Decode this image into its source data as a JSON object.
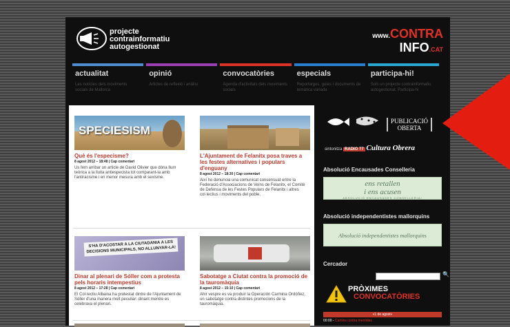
{
  "site": {
    "logo_lines": [
      "projecte",
      "contrainformatiu",
      "autogestionat"
    ],
    "brand_www": "www.",
    "brand_contra": "CONTRA",
    "brand_info": "INFO",
    "brand_tld": ".CAT"
  },
  "nav": [
    {
      "label": "actualitat",
      "desc": "Les notícies dels moviments socials de Mallorca",
      "color": "#4f8fd1"
    },
    {
      "label": "opinió",
      "desc": "Articles de reflexió i anàlisi",
      "color": "#9b3fb5"
    },
    {
      "label": "convocatòries",
      "desc": "Agenda d'activitats dels moviments socials",
      "color": "#e03127"
    },
    {
      "label": "especials",
      "desc": "Reportatges, guies i documents de temàtica variada",
      "color": "#2b7fd1"
    },
    {
      "label": "participa-hi!",
      "desc": "Sols un projecte contrainformatiu autogestionat. Participa-hi",
      "color": "#2ba8d1"
    }
  ],
  "posts": [
    {
      "title": "Què és l'especisme?",
      "meta": "8 agost 2012 – 18:48 | Cap comentari",
      "excerpt": "Us fem arribar un article de David Olivier que dóna llum teòrica a la lluita antiespecista tot comparant-la amb l'antiracisme i en menor mesura amb el sexisme.",
      "thumb_text": "SPECIESISM"
    },
    {
      "title": "L'Ajuntament de Felanitx posa traves a les festes alternatives i populars d'enguany",
      "meta": "8 agost 2012 – 18:30 | Cap comentari",
      "excerpt": "Així ho denuncia una comunicat consensuat entre la Federació d'Associacions de Veïns de Felanitx, el Comitè de Defensa de les Festes Populars de Felanitx i altres col·lectius i moviments del poble."
    },
    {
      "title": "Dinar al plenari de Sóller com a protesta pels horaris intempestius",
      "meta": "8 agost 2012 – 17:28 | Cap comentari",
      "excerpt": "El Col·lectiu Albaina ha protestat dintre de l'Ajuntament de Sóller d'una manera molt peculiar: dinant mentre es celebrava el plenari.",
      "thumb_text": "S'HA D'ACOSTAR A LA CIUTADANIA A LES DECISIONS MUNICIPALS, NO ALLUNYAR-LA!"
    },
    {
      "title": "Sabotatge a Ciutat contra la promoció de la tauromàquia",
      "meta": "8 agost 2012 – 15:10 | Cap comentari",
      "excerpt": "Ahir vespre es va produir la Operación Carmina Ordóñez, un sabotatge contra distintes promocions de la tauromàquia."
    }
  ],
  "sidebar": {
    "pub_line1": "PUBLICACIÓ",
    "pub_line2": "OBERTA",
    "radio_prefix": "sintonitza",
    "radio_station": "RADIO 77",
    "radio_name": "Cultura Obrera",
    "section1_title": "Absolució Encausades Conselleria",
    "banner1_line1": "ens retallen",
    "banner1_line2": "i ens acusen",
    "banner1_line3": "ABSOLUCIÓ ENCAUSADES CONSELLERIA!",
    "section2_title": "Absolució independentistes mallorquins",
    "banner2": "Absolució independentistes mallorquins",
    "search_title": "Cercador",
    "prox_line1": "PRÒXIMES",
    "prox_line2": "CONVOCATÒRIES",
    "date_bar": "»1 de agost«",
    "event_time": "00:00 -",
    "event_text": "Camins contra mentides"
  },
  "colors": {
    "accent": "#e03127",
    "link": "#c0392b"
  }
}
